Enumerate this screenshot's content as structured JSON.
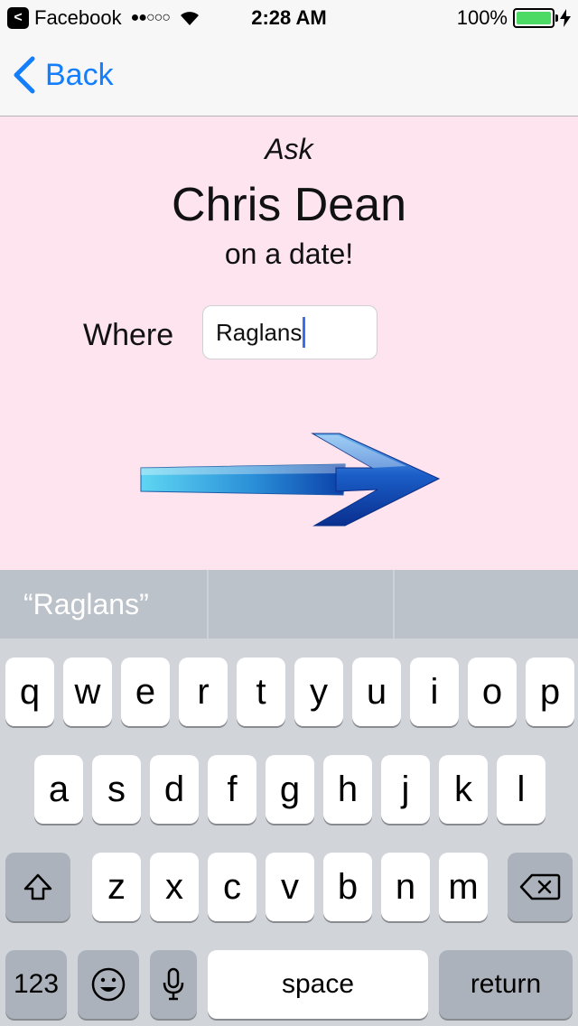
{
  "status_bar": {
    "back_app_glyph": "<",
    "app_name": "Facebook",
    "signal": "●●○○○",
    "time": "2:28 AM",
    "battery": "100%",
    "battery_level": 1.0,
    "battery_color": "#4cd964"
  },
  "nav": {
    "back_label": "Back",
    "accent_color": "#147efb"
  },
  "content": {
    "background_color": "#fde4ee",
    "ask": "Ask",
    "name": "Chris Dean",
    "subtitle": "on a date!",
    "where_label": "Where",
    "where_value": "Raglans",
    "next_icon": "arrow-right-icon"
  },
  "suggestions": [
    "“Raglans”",
    "",
    ""
  ],
  "keyboard": {
    "row1": [
      "q",
      "w",
      "e",
      "r",
      "t",
      "y",
      "u",
      "i",
      "o",
      "p"
    ],
    "row2": [
      "a",
      "s",
      "d",
      "f",
      "g",
      "h",
      "j",
      "k",
      "l"
    ],
    "row3": [
      "z",
      "x",
      "c",
      "v",
      "b",
      "n",
      "m"
    ],
    "shift_icon": "shift-icon",
    "delete_icon": "backspace-icon",
    "numbers_label": "123",
    "emoji_icon": "emoji-icon",
    "mic_icon": "microphone-icon",
    "space_label": "space",
    "return_label": "return"
  }
}
